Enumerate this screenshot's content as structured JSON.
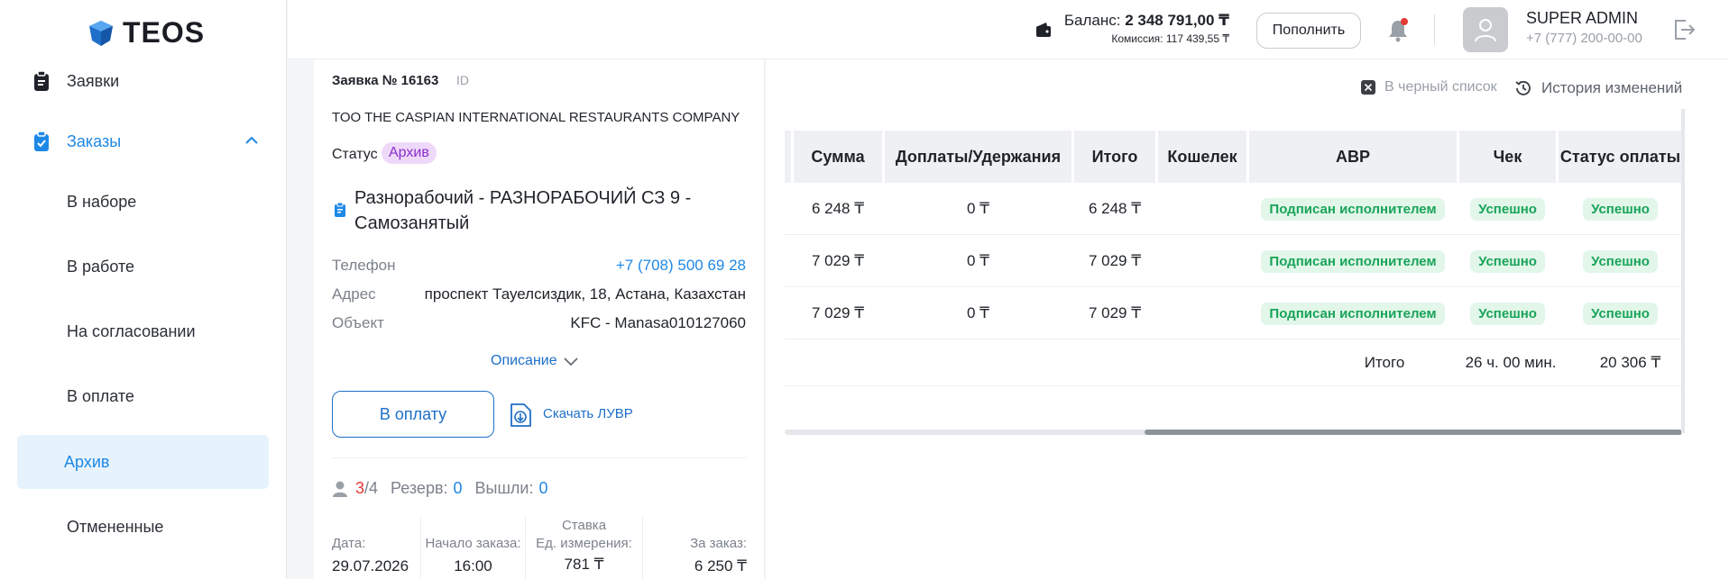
{
  "app": {
    "logo_text": "TEOS"
  },
  "sidebar": {
    "items": [
      {
        "label": "Заявки"
      },
      {
        "label": "Заказы"
      },
      {
        "label": "В наборе"
      },
      {
        "label": "В работе"
      },
      {
        "label": "На согласовании"
      },
      {
        "label": "В оплате"
      },
      {
        "label": "Архив"
      },
      {
        "label": "Отмененные"
      }
    ]
  },
  "header": {
    "balance_label": "Баланс:",
    "balance_value": "2 348 791,00 ₸",
    "commission_label": "Комиссия:",
    "commission_value": "117 439,55 ₸",
    "topup_label": "Пополнить",
    "user_name": "SUPER ADMIN",
    "user_phone": "+7 (777) 200-00-00"
  },
  "order": {
    "title": "Заявка № 16163",
    "id_label": "ID",
    "company": "TOO THE CASPIAN INTERNATIONAL RESTAURANTS COMPANY",
    "status_label": "Статус",
    "status_value": "Архив",
    "job_title": "Разнорабочий - РАЗНОРАБОЧИЙ СЗ 9 - Самозанятый",
    "phone_label": "Телефон",
    "phone_value": "+7 (708) 500 69 28",
    "address_label": "Адрес",
    "address_value": "проспект Тауелсиздик, 18, Астана, Казахстан",
    "object_label": "Объект",
    "object_value": "KFC - Manasa010127060",
    "description_label": "Описание",
    "pay_button": "В оплату",
    "download_label": "Скачать ЛУВР",
    "staff_current": "3",
    "staff_sep": "/",
    "staff_total": "4",
    "reserve_label": "Резерв:",
    "reserve_value": "0",
    "left_label": "Вышли:",
    "left_value": "0",
    "date_label": "Дата:",
    "date_value": "29.07.2026",
    "start_label": "Начало заказа:",
    "start_value": "16:00",
    "rate_label_1": "Ставка",
    "rate_label_2": "Ед. измерения:",
    "rate_value": "781 ₸",
    "total_label": "За заказ:",
    "total_value": "6 250 ₸"
  },
  "actions": {
    "blacklist": "В черный список",
    "history": "История изменений"
  },
  "table": {
    "headers": [
      "Сумма",
      "Доплаты/Удержания",
      "Итого",
      "Кошелек",
      "АВР",
      "Чек",
      "Статус оплаты"
    ],
    "rows": [
      {
        "sum": "6 248 ₸",
        "extra": "0 ₸",
        "total": "6 248 ₸",
        "wallet": "",
        "avr": "Подписан исполнителем",
        "check": "Успешно",
        "pay_status": "Успешно"
      },
      {
        "sum": "7 029 ₸",
        "extra": "0 ₸",
        "total": "7 029 ₸",
        "wallet": "",
        "avr": "Подписан исполнителем",
        "check": "Успешно",
        "pay_status": "Успешно"
      },
      {
        "sum": "7 029 ₸",
        "extra": "0 ₸",
        "total": "7 029 ₸",
        "wallet": "",
        "avr": "Подписан исполнителем",
        "check": "Успешно",
        "pay_status": "Успешно"
      }
    ],
    "footer_label": "Итого",
    "footer_hours": "26 ч. 00 мин.",
    "footer_sum": "20 306 ₸"
  },
  "colors": {
    "accent": "#1e88e5",
    "success": "#19a45a",
    "archive": "#8b2fc9"
  }
}
